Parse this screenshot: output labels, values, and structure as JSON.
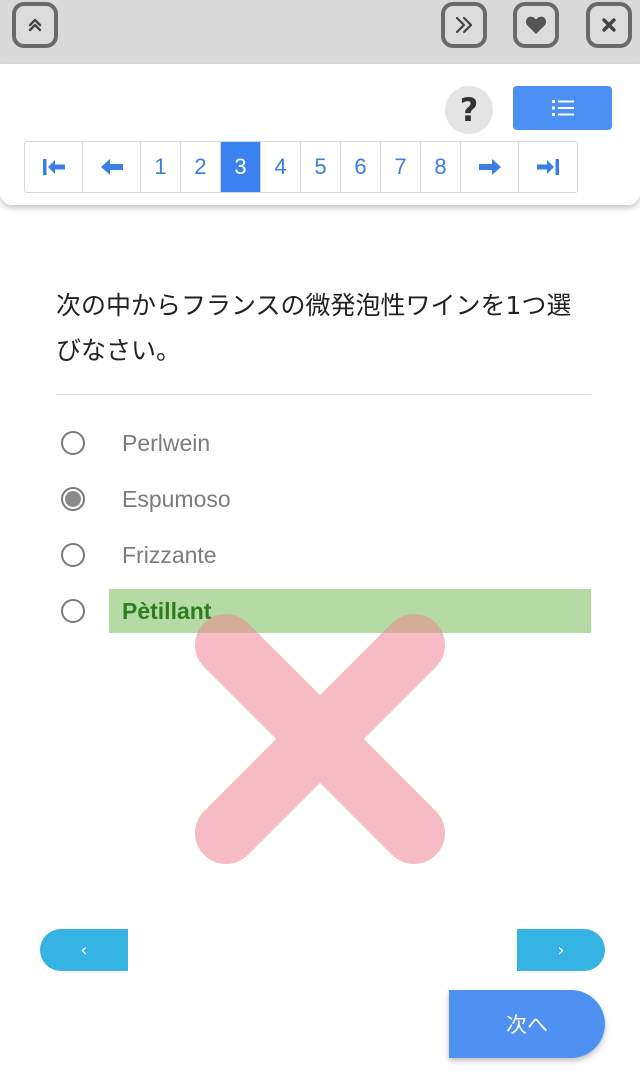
{
  "toolbar": {
    "collapse_icon": "double-chevron-up",
    "skip_icon": "double-chevron-right",
    "favorite_icon": "heart",
    "close_icon": "close-x"
  },
  "header": {
    "help_label": "?",
    "list_icon": "list",
    "pagination": {
      "first_icon": "arrow-to-first",
      "prev_icon": "arrow-left",
      "pages": [
        "1",
        "2",
        "3",
        "4",
        "5",
        "6",
        "7",
        "8"
      ],
      "current_page": "3",
      "next_icon": "arrow-right",
      "last_icon": "arrow-to-last"
    }
  },
  "question": {
    "text": "次の中からフランスの微発泡性ワインを1つ選びなさい。",
    "options": [
      {
        "label": "Perlwein",
        "selected": false,
        "correct": false
      },
      {
        "label": "Espumoso",
        "selected": true,
        "correct": false
      },
      {
        "label": "Frizzante",
        "selected": false,
        "correct": false
      },
      {
        "label": "Pètillant",
        "selected": false,
        "correct": true
      }
    ],
    "result": "incorrect"
  },
  "navigation": {
    "prev_label": "‹",
    "next_label": "›",
    "next_question_label": "次へ"
  },
  "colors": {
    "accent": "#3b82f0",
    "nav_button": "#35b3e3",
    "correct_highlight": "#b5dba5",
    "wrong_mark": "#f2b7bf"
  }
}
